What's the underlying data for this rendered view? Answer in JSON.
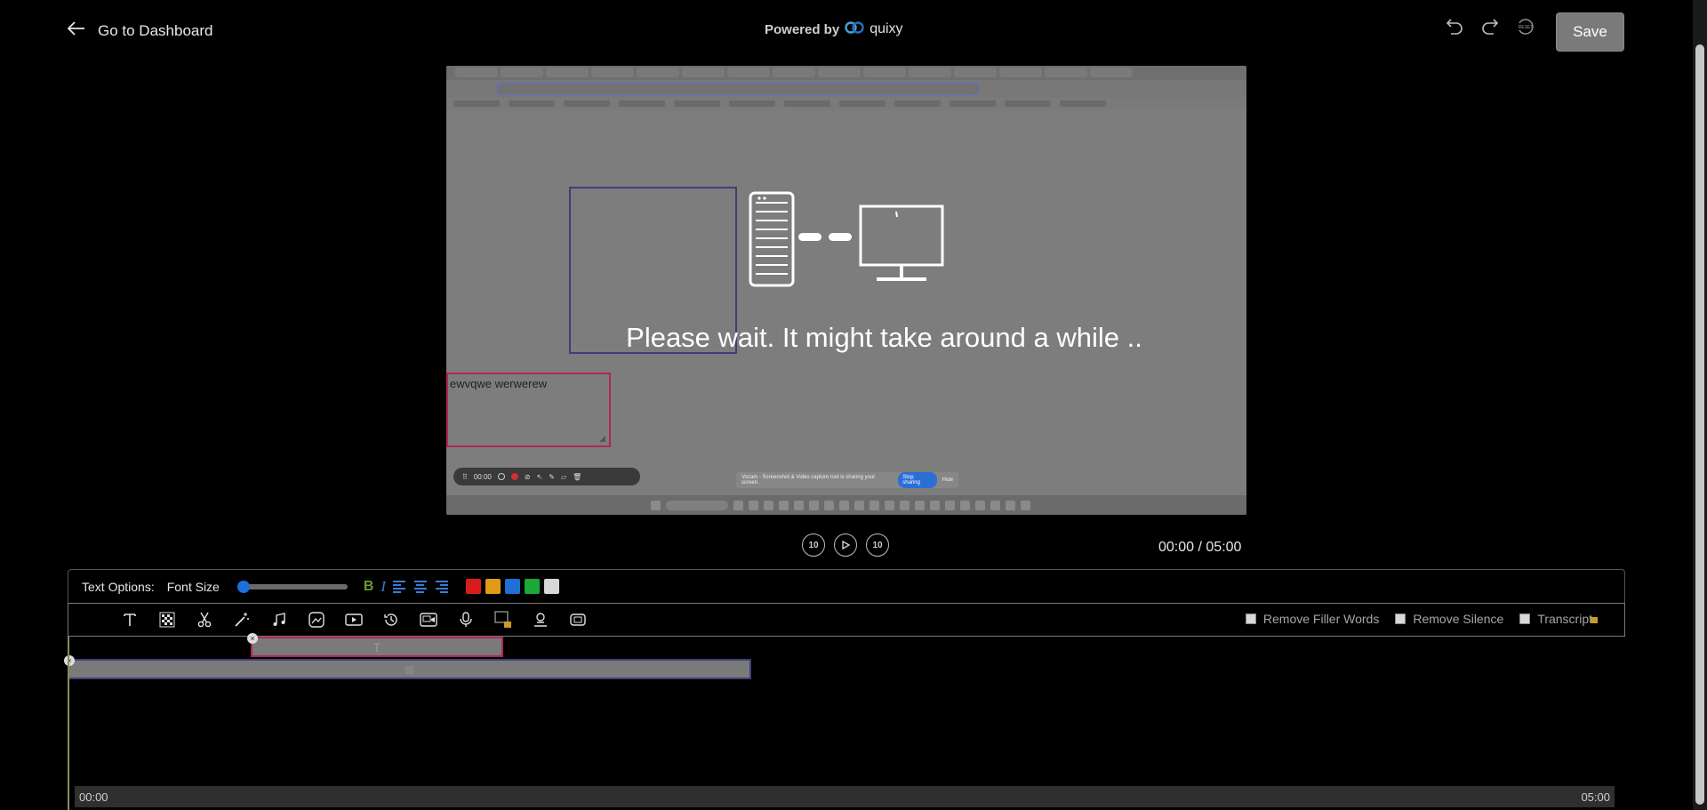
{
  "header": {
    "back_label": "Go to Dashboard",
    "powered_by": "Powered by",
    "brand": "quixy",
    "reset_label": "RESET",
    "save_label": "Save"
  },
  "preview": {
    "wait_message": "Please wait. It might take around a while ..",
    "note_text": "ewvqwe werwerew",
    "rec_time": "00:00",
    "share_text": "Vozam - Screenshot & Video capture tool is sharing your screen.",
    "stop_sharing": "Stop sharing",
    "hide": "Hide"
  },
  "playback": {
    "rewind_label": "10",
    "forward_label": "10",
    "current_time": "00:00",
    "separator": "/",
    "total_time": "05:00"
  },
  "text_options": {
    "label": "Text Options:",
    "font_size_label": "Font Size",
    "font_size_fraction": 0.0,
    "bold": "B",
    "italic": "I",
    "colors": [
      "#d81c1c",
      "#e09a1a",
      "#1f6fd6",
      "#1aa83a",
      "#d8d8d8"
    ]
  },
  "toolbar": {
    "tools": [
      "text-icon",
      "blur-icon",
      "scissors-icon",
      "magic-wand-icon",
      "music-icon",
      "image-edit-icon",
      "camera-icon",
      "history-icon",
      "video-overlay-icon",
      "microphone-icon",
      "locked-media-icon",
      "person-icon",
      "stamp-icon"
    ],
    "remove_filler": "Remove Filler Words",
    "remove_silence": "Remove Silence",
    "transcript": "Transcript"
  },
  "timeline": {
    "start_label": "00:00",
    "end_label": "05:00",
    "text_track_icon": "T"
  }
}
